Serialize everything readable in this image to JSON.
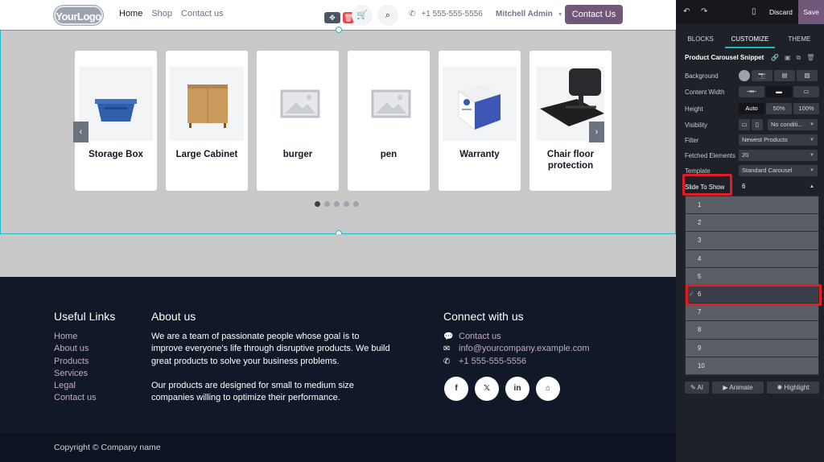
{
  "header": {
    "logo": "YourLogo",
    "nav": [
      "Home",
      "Shop",
      "Contact us"
    ],
    "phone": "+1 555-555-5556",
    "admin": "Mitchell Admin",
    "contact_button": "Contact Us"
  },
  "carousel": {
    "products": [
      "Storage Box",
      "Large Cabinet",
      "burger",
      "pen",
      "Warranty",
      "Chair floor protection"
    ],
    "dot_count": 5,
    "active_dot": 0
  },
  "footer": {
    "useful_links_title": "Useful Links",
    "useful_links": [
      "Home",
      "About us",
      "Products",
      "Services",
      "Legal",
      "Contact us"
    ],
    "about_title": "About us",
    "about_p1": "We are a team of passionate people whose goal is to improve everyone's life through disruptive products. We build great products to solve your business problems.",
    "about_p2": "Our products are designed for small to medium size companies willing to optimize their performance.",
    "connect_title": "Connect with us",
    "connect_contact": "Contact us",
    "connect_email": "info@yourcompany.example.com",
    "connect_phone": "+1 555-555-5556",
    "socials": [
      "f",
      "𝕏",
      "in",
      "⌂"
    ],
    "copyright": "Copyright © Company name"
  },
  "editor": {
    "discard": "Discard",
    "save": "Save",
    "tabs": [
      "BLOCKS",
      "CUSTOMIZE",
      "THEME"
    ],
    "active_tab": "CUSTOMIZE",
    "snippet_title": "Product Carousel Snippet",
    "options": {
      "background": "Background",
      "content_width": "Content Width",
      "height": "Height",
      "height_values": [
        "Auto",
        "50%",
        "100%"
      ],
      "visibility": "Visibility",
      "visibility_value": "No conditi...",
      "filter": "Filter",
      "filter_value": "Newest Products",
      "fetched": "Fetched Elements",
      "fetched_value": "20",
      "template": "Template",
      "template_value": "Standard Carousel",
      "slide": "Slide To Show",
      "slide_value": "6"
    },
    "slide_options": [
      "1",
      "2",
      "3",
      "4",
      "5",
      "6",
      "7",
      "8",
      "9",
      "10"
    ],
    "selected_slide": "6",
    "bottom_buttons": [
      "AI",
      "Animate",
      "Highlight"
    ]
  },
  "colors": {
    "accent": "#71587b",
    "selection": "#22b8c6",
    "highlight": "#e11d24"
  }
}
